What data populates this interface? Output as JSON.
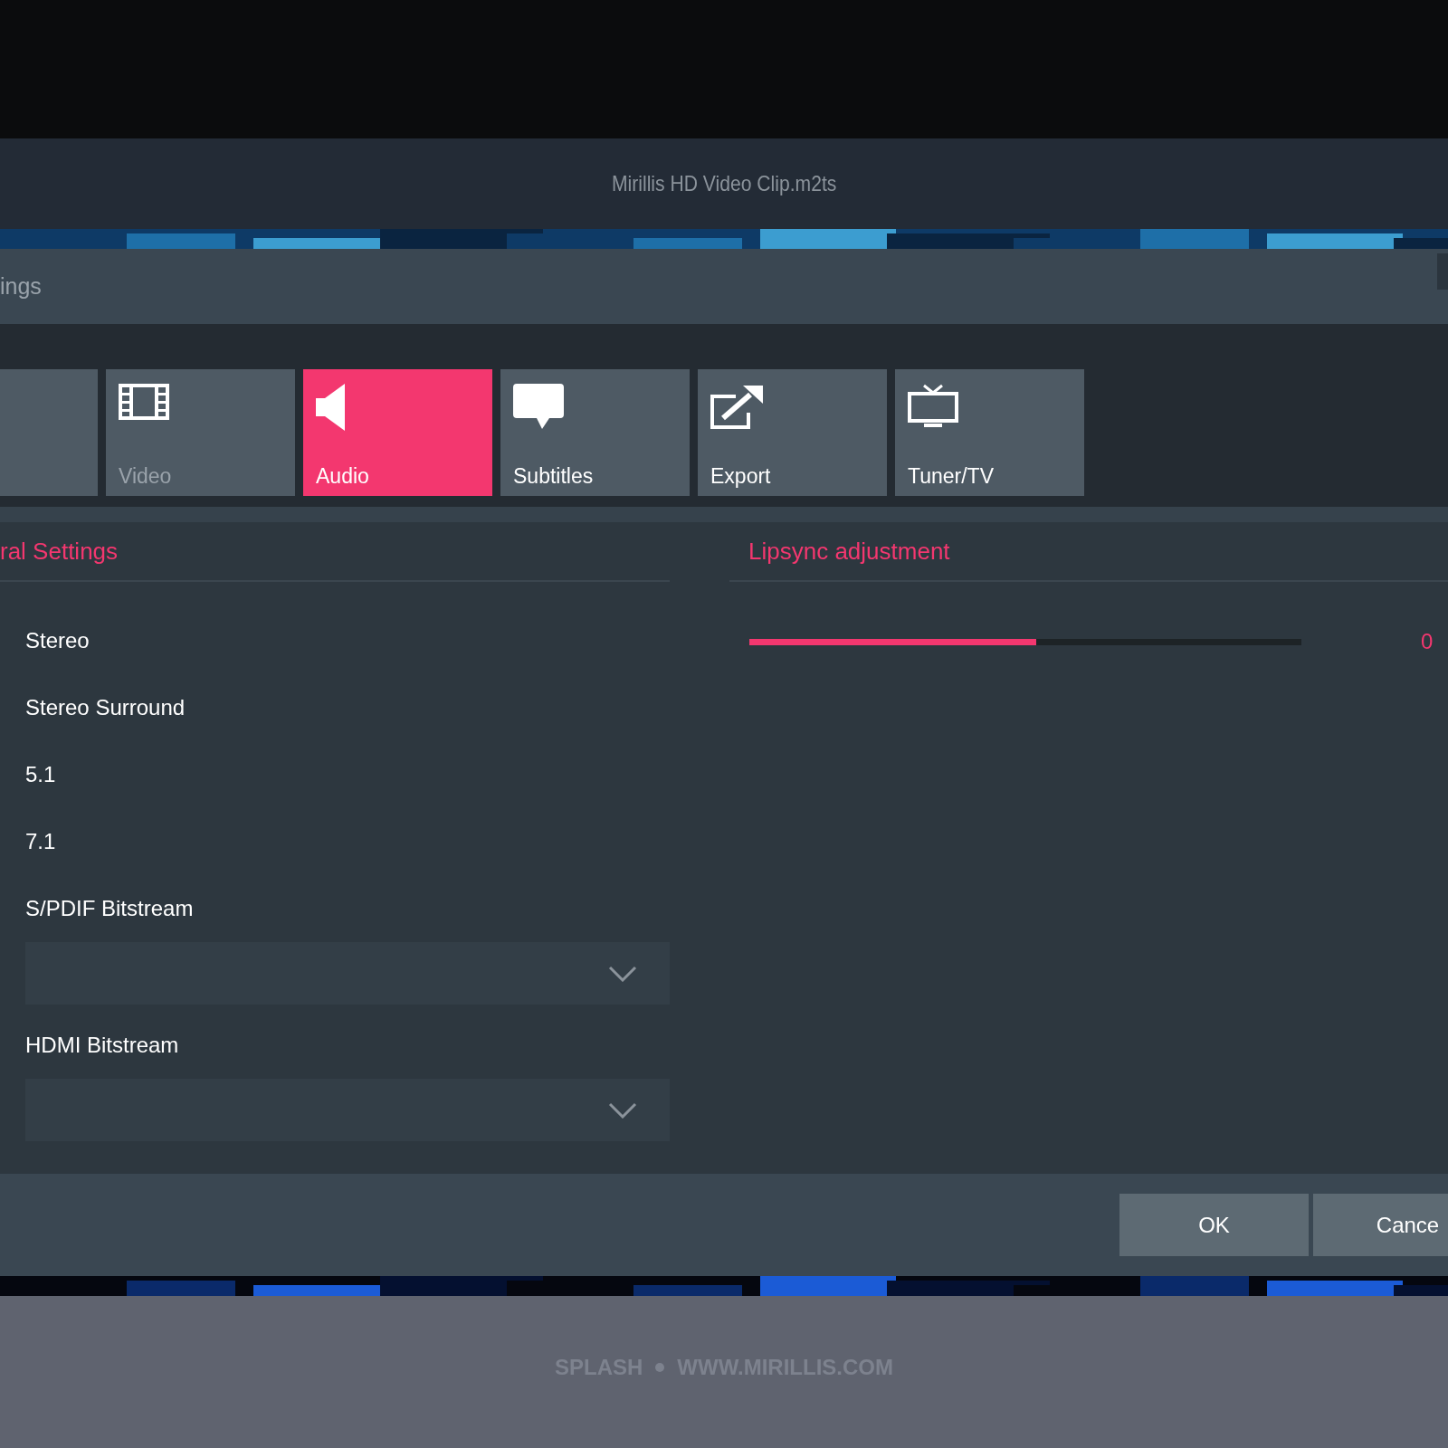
{
  "window": {
    "title": "Mirillis HD Video Clip.m2ts"
  },
  "header": {
    "title": "ings"
  },
  "tabs": [
    {
      "kind": "blank",
      "selected": false
    },
    {
      "label": "Video",
      "kind": "film",
      "selected": false,
      "disabled": true
    },
    {
      "label": "Audio",
      "kind": "speaker",
      "selected": true,
      "disabled": false
    },
    {
      "label": "Subtitles",
      "kind": "bubble",
      "selected": false,
      "disabled": false
    },
    {
      "label": "Export",
      "kind": "export",
      "selected": false,
      "disabled": false
    },
    {
      "label": "Tuner/TV",
      "kind": "tv",
      "selected": false,
      "disabled": false
    }
  ],
  "general": {
    "title": "ral Settings",
    "items": [
      {
        "kind": "option",
        "label": "Stereo"
      },
      {
        "kind": "option",
        "label": "Stereo Surround"
      },
      {
        "kind": "option",
        "label": "5.1"
      },
      {
        "kind": "option",
        "label": "7.1"
      },
      {
        "kind": "option",
        "label": "S/PDIF Bitstream"
      },
      {
        "kind": "dropdown"
      },
      {
        "kind": "option",
        "label": "HDMI Bitstream"
      },
      {
        "kind": "dropdown"
      }
    ]
  },
  "lipsync": {
    "title": "Lipsync adjustment",
    "level": 0.52,
    "reading": "0"
  },
  "buttons": [
    "OK",
    "Cance"
  ],
  "footer": {
    "left": "SPLASH",
    "right": "WWW.MIRILLIS.COM"
  }
}
